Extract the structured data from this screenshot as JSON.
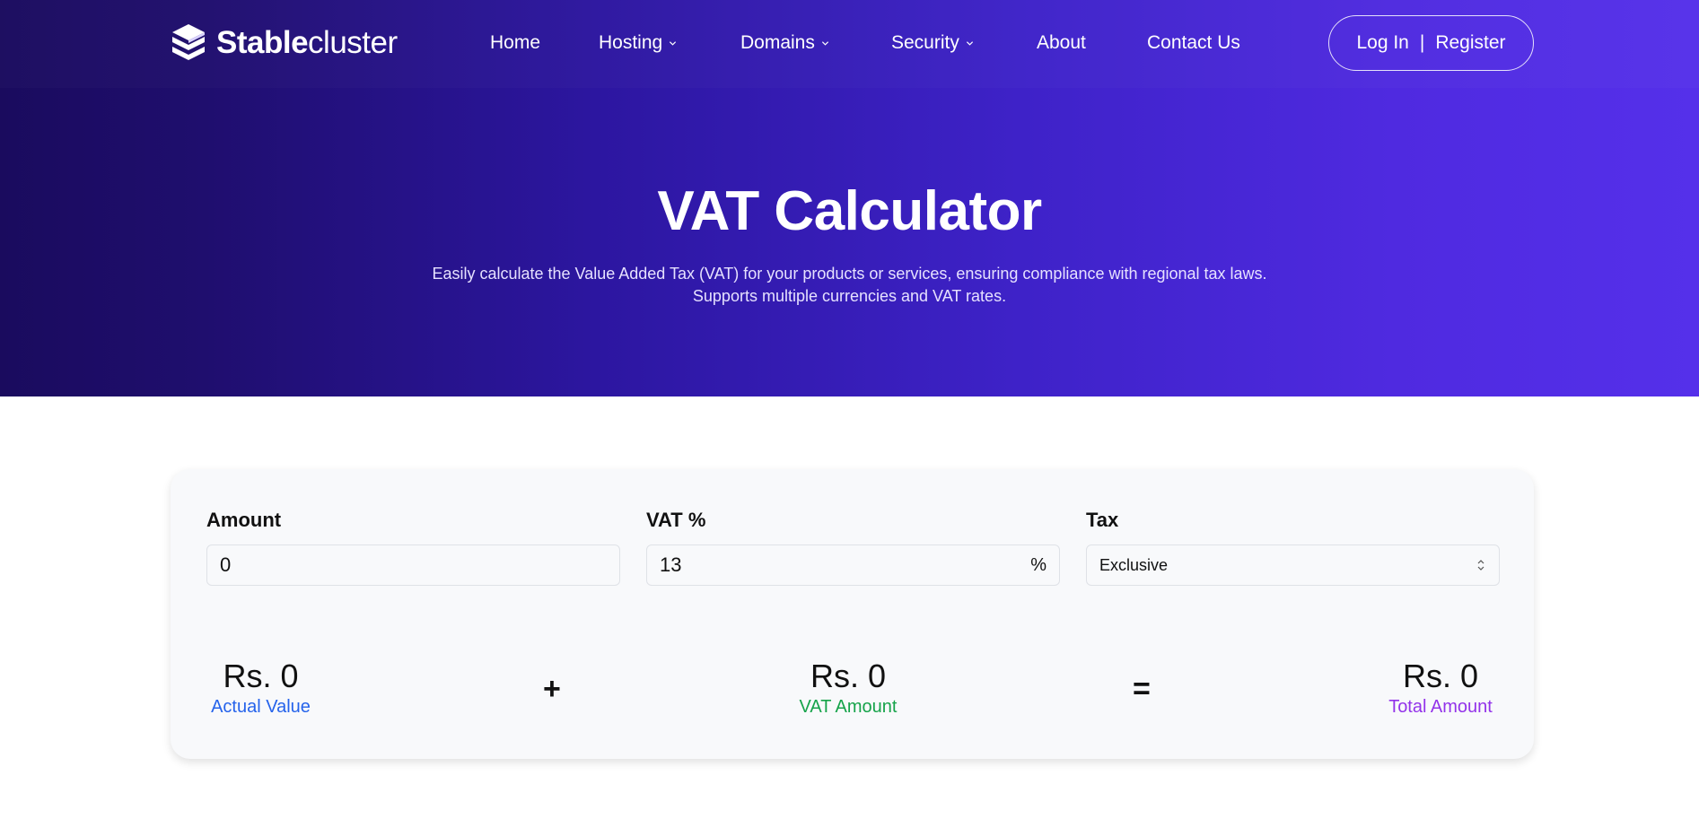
{
  "brand": {
    "name_bold": "Stable",
    "name_light": "cluster",
    "logo_icon": "stacked-cube-icon"
  },
  "nav": {
    "items": [
      {
        "label": "Home",
        "dropdown": false
      },
      {
        "label": "Hosting",
        "dropdown": true
      },
      {
        "label": "Domains",
        "dropdown": true
      },
      {
        "label": "Security",
        "dropdown": true
      },
      {
        "label": "About",
        "dropdown": false
      },
      {
        "label": "Contact Us",
        "dropdown": false
      }
    ],
    "login_label": "Log In",
    "separator": "|",
    "register_label": "Register"
  },
  "hero": {
    "title": "VAT Calculator",
    "subtitle_line1": "Easily calculate the Value Added Tax (VAT) for your products or services, ensuring compliance with regional tax laws.",
    "subtitle_line2": "Supports multiple currencies and VAT rates."
  },
  "calculator": {
    "amount": {
      "label": "Amount",
      "value": "0"
    },
    "vat": {
      "label": "VAT %",
      "value": "13",
      "suffix": "%"
    },
    "tax": {
      "label": "Tax",
      "selected": "Exclusive"
    },
    "results": {
      "actual": {
        "value": "Rs. 0",
        "label": "Actual Value"
      },
      "plus": "+",
      "vat_amount": {
        "value": "Rs. 0",
        "label": "VAT Amount"
      },
      "equals": "=",
      "total": {
        "value": "Rs. 0",
        "label": "Total Amount"
      }
    }
  },
  "colors": {
    "hero_start": "#1a0b5e",
    "hero_end": "#5530ea",
    "actual_label": "#2563eb",
    "vat_label": "#16a34a",
    "total_label": "#9333ea"
  }
}
